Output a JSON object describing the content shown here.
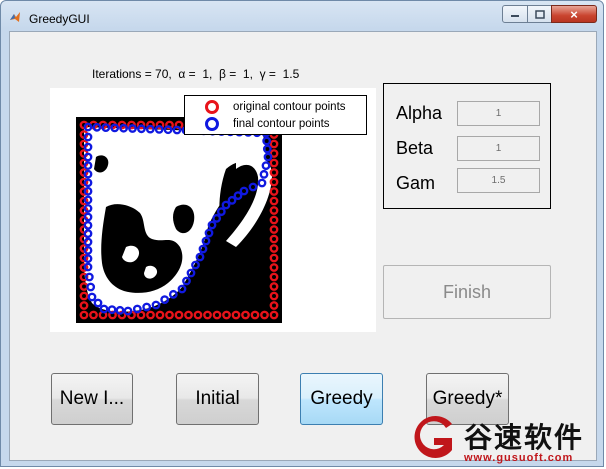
{
  "window": {
    "title": "GreedyGUI",
    "close_glyph": "×"
  },
  "status": {
    "iterations_text": "Iterations = 70,  α =  1,  β =  1,  γ =  1.5"
  },
  "legend": {
    "items": [
      {
        "label": "original contour points",
        "color": "#e8131a"
      },
      {
        "label": "final contour points",
        "color": "#1019e0"
      }
    ]
  },
  "params": {
    "alpha": {
      "label": "Alpha",
      "value": "1"
    },
    "beta": {
      "label": "Beta",
      "value": "1"
    },
    "gamma": {
      "label": "Gam",
      "value": "1.5"
    }
  },
  "buttons": {
    "finish": "Finish",
    "new_image": "New I...",
    "initial": "Initial",
    "greedy": "Greedy",
    "greedy_star": "Greedy*"
  },
  "watermark": {
    "brand": "谷速软件",
    "url": "www.gusuoft.com"
  },
  "colors": {
    "original_points": "#e8131a",
    "final_points": "#1019e0",
    "watermark_red": "#c0161b"
  }
}
